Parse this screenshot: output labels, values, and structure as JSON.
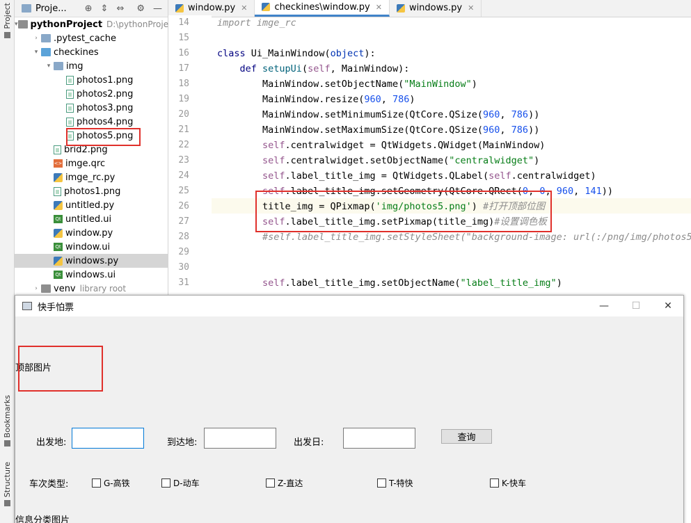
{
  "left_strip": {
    "project": "Project",
    "bookmarks": "Bookmarks",
    "structure": "Structure"
  },
  "project_panel": {
    "title": "Proje...",
    "tree": [
      {
        "label": "pythonProject",
        "extra": "D:\\pythonProje",
        "bold": true,
        "arrow": "▾",
        "depth": 0,
        "icon": "folder-gray"
      },
      {
        "label": ".pytest_cache",
        "arrow": "›",
        "depth": 1,
        "icon": "folder"
      },
      {
        "label": "checkines",
        "arrow": "▾",
        "depth": 1,
        "icon": "folder-blue"
      },
      {
        "label": "img",
        "arrow": "▾",
        "depth": 2,
        "icon": "folder"
      },
      {
        "label": "photos1.png",
        "depth": 3,
        "icon": "img"
      },
      {
        "label": "photos2.png",
        "depth": 3,
        "icon": "img"
      },
      {
        "label": "photos3.png",
        "depth": 3,
        "icon": "img"
      },
      {
        "label": "photos4.png",
        "depth": 3,
        "icon": "img"
      },
      {
        "label": "photos5.png",
        "depth": 3,
        "icon": "img"
      },
      {
        "label": "brid2.png",
        "depth": 2,
        "icon": "img"
      },
      {
        "label": "imge.qrc",
        "depth": 2,
        "icon": "qrc"
      },
      {
        "label": "imge_rc.py",
        "depth": 2,
        "icon": "py"
      },
      {
        "label": "photos1.png",
        "depth": 2,
        "icon": "img"
      },
      {
        "label": "untitled.py",
        "depth": 2,
        "icon": "py"
      },
      {
        "label": "untitled.ui",
        "depth": 2,
        "icon": "ui"
      },
      {
        "label": "window.py",
        "depth": 2,
        "icon": "py"
      },
      {
        "label": "window.ui",
        "depth": 2,
        "icon": "ui"
      },
      {
        "label": "windows.py",
        "depth": 2,
        "icon": "py",
        "selected": true
      },
      {
        "label": "windows.ui",
        "depth": 2,
        "icon": "ui"
      },
      {
        "label": "venv",
        "extra": "library root",
        "arrow": "›",
        "depth": 1,
        "icon": "folder-gray"
      }
    ]
  },
  "editor": {
    "tabs": [
      {
        "label": "window.py",
        "active": false
      },
      {
        "label": "checkines\\window.py",
        "active": true
      },
      {
        "label": "windows.py",
        "active": false
      }
    ],
    "line_numbers": [
      "14",
      "15",
      "16",
      "17",
      "18",
      "19",
      "20",
      "21",
      "22",
      "23",
      "24",
      "25",
      "26",
      "27",
      "28",
      "29",
      "30",
      "31"
    ],
    "lines": [
      [
        [
          "cmt",
          "import imge_rc"
        ]
      ],
      [],
      [
        [
          "kw",
          "class "
        ],
        [
          "plain",
          "Ui_MainWindow("
        ],
        [
          "kwb",
          "object"
        ],
        [
          "plain",
          "):"
        ]
      ],
      [
        [
          "plain",
          "    "
        ],
        [
          "kw",
          "def "
        ],
        [
          "fn",
          "setupUi"
        ],
        [
          "plain",
          "("
        ],
        [
          "slf",
          "self"
        ],
        [
          "plain",
          ", MainWindow):"
        ]
      ],
      [
        [
          "plain",
          "        MainWindow.setObjectName("
        ],
        [
          "str",
          "\"MainWindow\""
        ],
        [
          "plain",
          ")"
        ]
      ],
      [
        [
          "plain",
          "        MainWindow.resize("
        ],
        [
          "num",
          "960"
        ],
        [
          "plain",
          ", "
        ],
        [
          "num",
          "786"
        ],
        [
          "plain",
          ")"
        ]
      ],
      [
        [
          "plain",
          "        MainWindow.setMinimumSize(QtCore.QSize("
        ],
        [
          "num",
          "960"
        ],
        [
          "plain",
          ", "
        ],
        [
          "num",
          "786"
        ],
        [
          "plain",
          "))"
        ]
      ],
      [
        [
          "plain",
          "        MainWindow.setMaximumSize(QtCore.QSize("
        ],
        [
          "num",
          "960"
        ],
        [
          "plain",
          ", "
        ],
        [
          "num",
          "786"
        ],
        [
          "plain",
          "))"
        ]
      ],
      [
        [
          "plain",
          "        "
        ],
        [
          "slf",
          "self"
        ],
        [
          "plain",
          ".centralwidget = QtWidgets.QWidget(MainWindow)"
        ]
      ],
      [
        [
          "plain",
          "        "
        ],
        [
          "slf",
          "self"
        ],
        [
          "plain",
          ".centralwidget.setObjectName("
        ],
        [
          "str",
          "\"centralwidget\""
        ],
        [
          "plain",
          ")"
        ]
      ],
      [
        [
          "plain",
          "        "
        ],
        [
          "slf",
          "self"
        ],
        [
          "plain",
          ".label_title_img = QtWidgets.QLabel("
        ],
        [
          "slf",
          "self"
        ],
        [
          "plain",
          ".centralwidget)"
        ]
      ],
      [
        [
          "plain",
          "        "
        ],
        [
          "slf",
          "self"
        ],
        [
          "plain",
          ".label_title_img.setGeometry(QtCore.QRect("
        ],
        [
          "num",
          "0"
        ],
        [
          "plain",
          ", "
        ],
        [
          "num",
          "0"
        ],
        [
          "plain",
          ", "
        ],
        [
          "num",
          "960"
        ],
        [
          "plain",
          ", "
        ],
        [
          "num",
          "141"
        ],
        [
          "plain",
          "))"
        ]
      ],
      [
        [
          "plain",
          "        title_img = QPixmap("
        ],
        [
          "str",
          "'img/photos5.png'"
        ],
        [
          "plain",
          ") "
        ],
        [
          "cmt",
          "#打开顶部位图"
        ]
      ],
      [
        [
          "plain",
          "        "
        ],
        [
          "slf",
          "self"
        ],
        [
          "plain",
          ".label_title_img.setPixmap(title_img)"
        ],
        [
          "cmt",
          "#设置调色板"
        ]
      ],
      [
        [
          "cmt",
          "        #self.label_title_img.setStyleSheet(\"background-image: url(:/png/img/photos5."
        ]
      ],
      [],
      [],
      [
        [
          "plain",
          "        "
        ],
        [
          "slf",
          "self"
        ],
        [
          "plain",
          ".label_title_img.setObjectName("
        ],
        [
          "str",
          "\"label_title_img\""
        ],
        [
          "plain",
          ")"
        ]
      ]
    ]
  },
  "qt_window": {
    "title": "快手怕票",
    "controls": {
      "minimize": "—",
      "maximize": "☐",
      "close": "✕"
    },
    "top_image_label": "顶部图片",
    "from_label": "出发地:",
    "to_label": "到达地:",
    "date_label": "出发日:",
    "from_value": "",
    "to_value": "",
    "date_value": "",
    "query_button": "查询",
    "train_type_label": "车次类型:",
    "train_types": [
      "G-高铁",
      "D-动车",
      "Z-直达",
      "T-特快",
      "K-快车"
    ],
    "info_label": "信息分类图片"
  }
}
